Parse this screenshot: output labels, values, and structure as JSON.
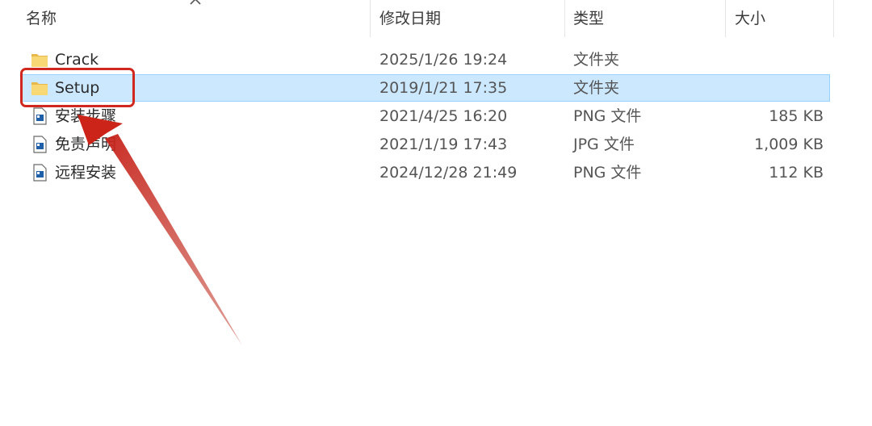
{
  "header": {
    "columns": {
      "name": "名称",
      "date": "修改日期",
      "type": "类型",
      "size": "大小"
    },
    "sort_icon": "chevron-up-icon"
  },
  "files": [
    {
      "name": "Crack",
      "date": "2025/1/26 19:24",
      "type": "文件夹",
      "size": "",
      "icon": "folder-icon",
      "selected": false
    },
    {
      "name": "Setup",
      "date": "2019/1/21 17:35",
      "type": "文件夹",
      "size": "",
      "icon": "folder-icon",
      "selected": true
    },
    {
      "name": "安装步骤",
      "date": "2021/4/25 16:20",
      "type": "PNG 文件",
      "size": "185 KB",
      "icon": "image-file-icon",
      "selected": false
    },
    {
      "name": "免责声明",
      "date": "2021/1/19 17:43",
      "type": "JPG 文件",
      "size": "1,009 KB",
      "icon": "image-file-icon",
      "selected": false
    },
    {
      "name": "远程安装",
      "date": "2024/12/28 21:49",
      "type": "PNG 文件",
      "size": "112 KB",
      "icon": "image-file-icon",
      "selected": false
    }
  ],
  "colors": {
    "selection_bg": "#cce8ff",
    "selection_border": "#99d1ff",
    "annotation_red": "#d0281e",
    "folder_yellow": "#f8d775"
  }
}
